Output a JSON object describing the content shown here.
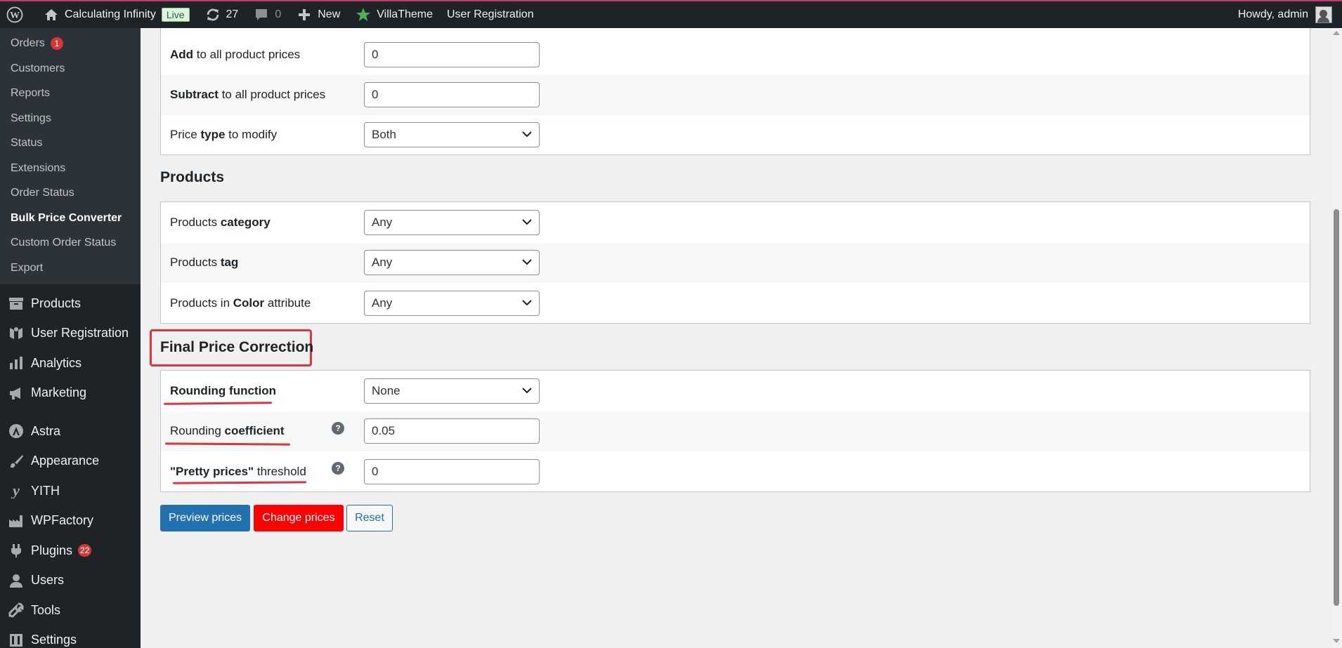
{
  "adminbar": {
    "site_name": "Calculating Infinity",
    "live_label": "Live",
    "updates_count": "27",
    "comments_count": "0",
    "new_label": "New",
    "villatheme_label": "VillaTheme",
    "user_registration_label": "User Registration",
    "howdy": "Howdy, admin"
  },
  "sidebar": {
    "submenu": [
      {
        "label": "Orders",
        "badge": "1"
      },
      {
        "label": "Customers"
      },
      {
        "label": "Reports"
      },
      {
        "label": "Settings"
      },
      {
        "label": "Status"
      },
      {
        "label": "Extensions"
      },
      {
        "label": "Order Status"
      },
      {
        "label": "Bulk Price Converter"
      },
      {
        "label": "Custom Order Status"
      },
      {
        "label": "Export"
      }
    ],
    "menu": [
      {
        "label": "Products",
        "icon": "archive-icon"
      },
      {
        "label": "User Registration",
        "icon": "user-registration-icon"
      },
      {
        "label": "Analytics",
        "icon": "bar-chart-icon"
      },
      {
        "label": "Marketing",
        "icon": "megaphone-icon"
      },
      {
        "label": "Astra",
        "icon": "astra-icon"
      },
      {
        "label": "Appearance",
        "icon": "paintbrush-icon"
      },
      {
        "label": "YITH",
        "icon": "yith-icon"
      },
      {
        "label": "WPFactory",
        "icon": "factory-icon"
      },
      {
        "label": "Plugins",
        "icon": "plugin-icon",
        "badge": "22"
      },
      {
        "label": "Users",
        "icon": "users-icon"
      },
      {
        "label": "Tools",
        "icon": "wrench-icon"
      },
      {
        "label": "Settings",
        "icon": "settings-icon"
      }
    ]
  },
  "price_settings": {
    "add_row": {
      "label_bold": "Add",
      "label_rest": " to all product prices",
      "value": "0"
    },
    "subtract_row": {
      "label_bold": "Subtract",
      "label_rest": " to all product prices",
      "value": "0"
    },
    "type_row": {
      "label_pre": "Price ",
      "label_bold": "type",
      "label_rest": " to modify",
      "value": "Both"
    }
  },
  "products": {
    "title": "Products",
    "category_row": {
      "label_pre": "Products ",
      "label_bold": "category",
      "value": "Any"
    },
    "tag_row": {
      "label_pre": "Products ",
      "label_bold": "tag",
      "value": "Any"
    },
    "color_row": {
      "label_pre": "Products in ",
      "label_bold": "Color",
      "label_rest": " attribute",
      "value": "Any"
    }
  },
  "final_correction": {
    "title": "Final Price Correction",
    "rounding_function": {
      "label_bold": "Rounding function",
      "value": "None"
    },
    "rounding_coefficient": {
      "label_pre": "Rounding ",
      "label_bold": "coefficient",
      "value": "0.05",
      "help": "?"
    },
    "pretty_prices": {
      "label_bold": "\"Pretty prices\"",
      "label_rest": " threshold",
      "value": "0",
      "help": "?"
    }
  },
  "buttons": {
    "preview": "Preview prices",
    "change": "Change prices",
    "reset": "Reset"
  },
  "colors": {
    "admin_dark": "#1d2327",
    "accent_blue": "#2271b1",
    "change_red": "#ff0000",
    "annotation_red": "#d9363e"
  }
}
